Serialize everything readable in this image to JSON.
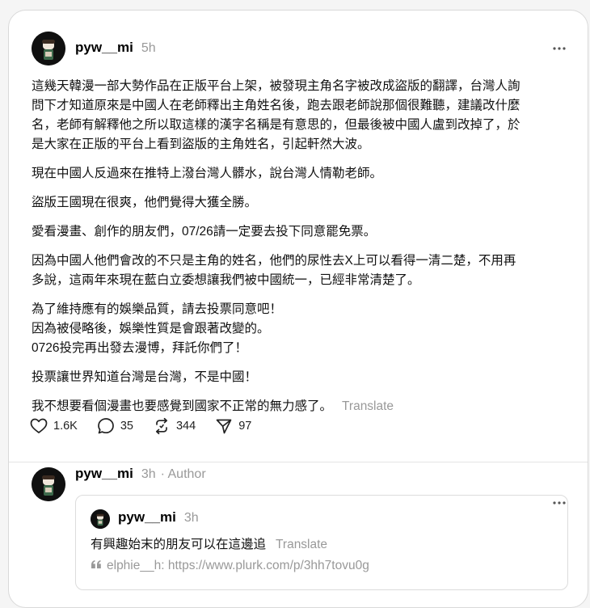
{
  "post": {
    "username": "pyw__mi",
    "time": "5h",
    "paragraphs": [
      "這幾天韓漫一部大勢作品在正版平台上架，被發現主角名字被改成盜版的翻譯，台灣人詢\n問下才知道原來是中國人在老師釋出主角姓名後，跑去跟老師說那個很難聽，建議改什麼\n名，老師有解釋他之所以取這樣的漢字名稱是有意思的，但最後被中國人盧到改掉了，於\n是大家在正版的平台上看到盜版的主角姓名，引起軒然大波。",
      "現在中國人反過來在推特上潑台灣人髒水，說台灣人情勒老師。",
      "盜版王國現在很爽，他們覺得大獲全勝。",
      "愛看漫畫、創作的朋友們，07/26請一定要去投下同意罷免票。",
      "因為中國人他們會改的不只是主角的姓名，他們的尿性去X上可以看得一清二楚，不用再\n多說，這兩年來現在藍白立委想讓我們被中國統一，已經非常清楚了。",
      "為了維持應有的娛樂品質，請去投票同意吧！\n因為被侵略後，娛樂性質是會跟著改變的。\n0726投完再出發去漫博，拜託你們了！",
      "投票讓世界知道台灣是台灣，不是中國！"
    ],
    "last_paragraph": "我不想要看個漫畫也要感覺到國家不正常的無力感了。",
    "translate_label": "Translate",
    "likes": "1.6K",
    "comments": "35",
    "reposts": "344",
    "shares": "97"
  },
  "reply": {
    "username": "pyw__mi",
    "time": "3h",
    "author_label": "· Author",
    "quote": {
      "username": "pyw__mi",
      "time": "3h",
      "text": "有興趣始末的朋友可以在這邊追",
      "translate_label": "Translate",
      "link_text": "elphie__h: https://www.plurk.com/p/3hh7tovu0g"
    }
  },
  "colors": {
    "muted": "#999999",
    "border": "#d9d9d9",
    "text": "#111111"
  },
  "icons": [
    "avatar",
    "more-icon",
    "heart-icon",
    "comment-icon",
    "repost-icon",
    "share-icon",
    "quote-mark-icon"
  ]
}
